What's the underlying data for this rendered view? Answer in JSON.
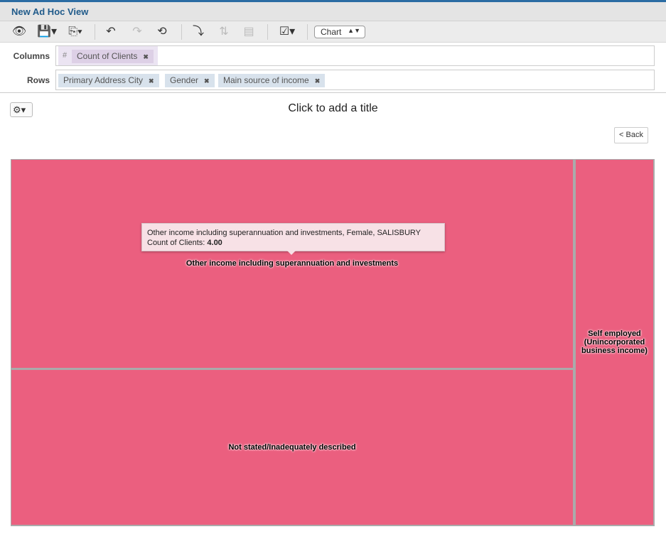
{
  "window": {
    "title": "New Ad Hoc View"
  },
  "toolbar": {
    "view_type": "Chart"
  },
  "columns": {
    "label": "Columns",
    "hash": "#",
    "fields": [
      "Count of Clients"
    ]
  },
  "rows": {
    "label": "Rows",
    "fields": [
      "Primary Address City",
      "Gender",
      "Main source of income"
    ]
  },
  "chart": {
    "title_placeholder": "Click to add a title",
    "back_label": "< Back",
    "fill_color": "#eb5f7f"
  },
  "tooltip": {
    "line1": "Other income including superannuation and investments, Female, SALISBURY",
    "measure_label": "Count of Clients:",
    "measure_value": "4.00"
  },
  "chart_data": {
    "type": "treemap",
    "measure": "Count of Clients",
    "path": [
      "SALISBURY",
      "Female"
    ],
    "nodes": [
      {
        "label": "Other income including superannuation and investments",
        "value": 4.0
      },
      {
        "label": "Not stated/Inadequately described"
      },
      {
        "label": "Self employed (Unincorporated business income)"
      }
    ]
  }
}
